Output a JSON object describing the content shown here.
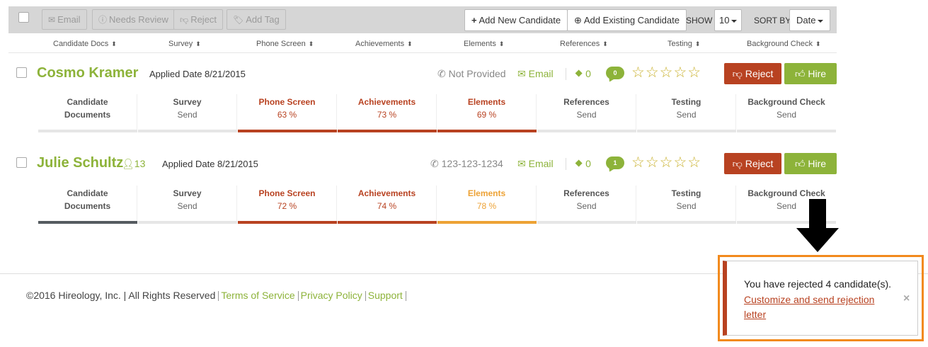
{
  "toolbar": {
    "email_label": "Email",
    "needs_review_label": "Needs Review",
    "reject_label": "Reject",
    "add_tag_label": "Add Tag",
    "add_new_label": "Add New Candidate",
    "add_existing_label": "Add Existing Candidate",
    "show_label": "SHOW",
    "show_value": "10",
    "sort_label": "SORT BY",
    "sort_value": "Date"
  },
  "columns": [
    "Candidate Docs",
    "Survey",
    "Phone Screen",
    "Achievements",
    "Elements",
    "References",
    "Testing",
    "Background Check"
  ],
  "candidates": [
    {
      "name": "Cosmo Kramer",
      "applied": "Applied Date 8/21/2015",
      "phone": "Not Provided",
      "email": "Email",
      "tags": "0",
      "comments": "0",
      "stars": "☆☆☆☆☆",
      "reject": "Reject",
      "hire": "Hire",
      "stages": [
        {
          "title": "Candidate",
          "title2": "Documents",
          "value": ""
        },
        {
          "title": "Survey",
          "value": "Send"
        },
        {
          "title": "Phone Screen",
          "value": "63 %"
        },
        {
          "title": "Achievements",
          "value": "73 %"
        },
        {
          "title": "Elements",
          "value": "69 %"
        },
        {
          "title": "References",
          "value": "Send"
        },
        {
          "title": "Testing",
          "value": "Send"
        },
        {
          "title": "Background Check",
          "value": "Send"
        }
      ]
    },
    {
      "name": "Julie Schultz",
      "referrals": "13",
      "applied": "Applied Date 8/21/2015",
      "phone": "123-123-1234",
      "email": "Email",
      "tags": "0",
      "comments": "1",
      "stars": "☆☆☆☆☆",
      "reject": "Reject",
      "hire": "Hire",
      "stages": [
        {
          "title": "Candidate",
          "title2": "Documents",
          "value": ""
        },
        {
          "title": "Survey",
          "value": "Send"
        },
        {
          "title": "Phone Screen",
          "value": "72 %"
        },
        {
          "title": "Achievements",
          "value": "74 %"
        },
        {
          "title": "Elements",
          "value": "78 %"
        },
        {
          "title": "References",
          "value": "Send"
        },
        {
          "title": "Testing",
          "value": "Send"
        },
        {
          "title": "Background Check",
          "value": "Send"
        }
      ]
    }
  ],
  "footer": {
    "copyright": "©2016 Hireology, Inc. | All Rights Reserved",
    "terms": "Terms of Service",
    "privacy": "Privacy Policy",
    "support": "Support"
  },
  "toast": {
    "message": "You have rejected 4 candidate(s).",
    "link": "Customize and send rejection letter",
    "close": "×"
  },
  "colors": {
    "brand_green": "#8db33a",
    "reject_red": "#b84221",
    "warning_orange": "#eda235",
    "annotation_orange": "#f28a1d"
  }
}
